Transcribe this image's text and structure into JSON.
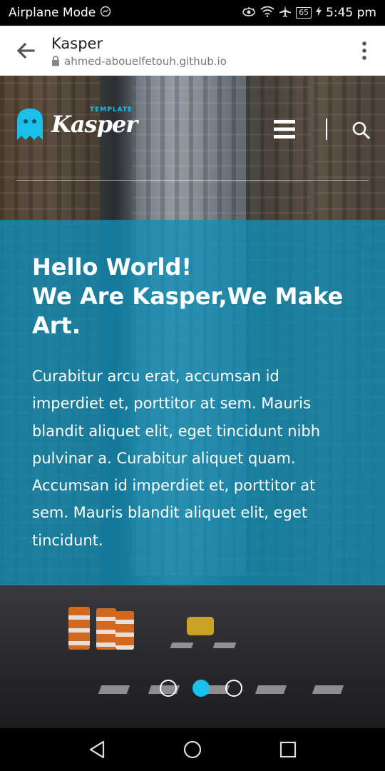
{
  "status_bar": {
    "mode_label": "Airplane Mode",
    "battery": "65",
    "time": "5:45 pm"
  },
  "browser": {
    "page_title": "Kasper",
    "url": "ahmed-abouelfetouh.github.io"
  },
  "site": {
    "logo": {
      "small_label": "TEMPLATE",
      "brand": "Kasper"
    },
    "hero": {
      "headline_lines": [
        "Hello World!",
        "We Are Kasper,We Make",
        "Art."
      ],
      "body": "Curabitur arcu erat, accumsan id imperdiet et, porttitor at sem. Mauris blandit aliquet elit, eget tincidunt nibh pulvinar a. Curabitur aliquet quam. Accumsan id imperdiet et, porttitor at sem. Mauris blandit aliquet elit, eget tincidunt."
    },
    "slider": {
      "count": 3,
      "active_index": 1
    }
  },
  "colors": {
    "accent": "#19c1ea",
    "overlay": "#0e8fb8"
  },
  "icons": {
    "back": "arrow-left-icon",
    "lock": "lock-icon",
    "menu": "kebab-menu-icon",
    "hamburger": "hamburger-icon",
    "search": "search-icon",
    "logo": "ghost-icon",
    "nav_back": "triangle-back-icon",
    "nav_home": "circle-home-icon",
    "nav_recents": "square-recents-icon"
  }
}
